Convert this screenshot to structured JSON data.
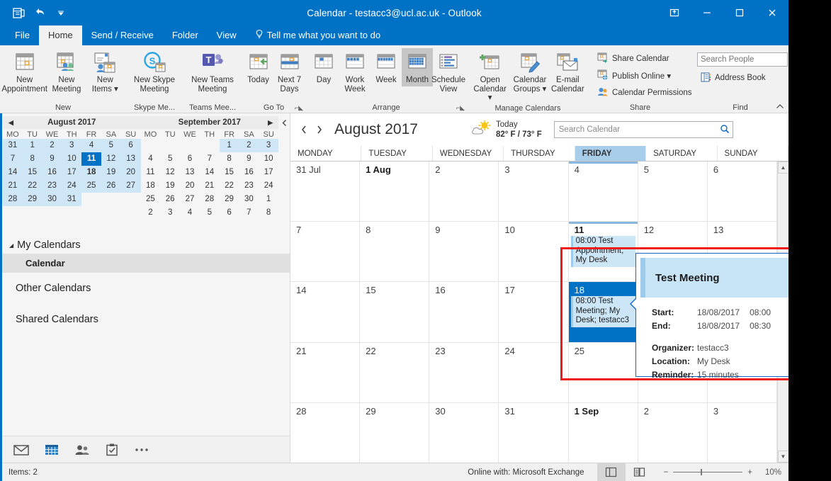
{
  "window": {
    "title": "Calendar - testacc3@ucl.ac.uk - Outlook",
    "restore_icon": "restore-window-icon",
    "minimize_icon": "minimize-icon",
    "maximize_icon": "maximize-icon",
    "close_icon": "close-icon",
    "qat": {
      "app_icon": "outlook-calendar-icon",
      "undo_icon": "undo-icon",
      "customize_icon": "chevron-down-icon"
    }
  },
  "tabs": [
    {
      "label": "File",
      "active": false
    },
    {
      "label": "Home",
      "active": true
    },
    {
      "label": "Send / Receive",
      "active": false
    },
    {
      "label": "Folder",
      "active": false
    },
    {
      "label": "View",
      "active": false
    }
  ],
  "tellme": {
    "label": "Tell me what you want to do",
    "icon": "lightbulb-icon"
  },
  "ribbon": {
    "groups": [
      {
        "label": "New",
        "buttons": [
          {
            "label": "New\nAppointment",
            "icon": "new-appointment-icon",
            "selected": false
          },
          {
            "label": "New\nMeeting",
            "icon": "new-meeting-icon",
            "selected": false
          },
          {
            "label": "New\nItems ▾",
            "icon": "new-items-icon",
            "selected": false
          }
        ]
      },
      {
        "label": "Skype Me...",
        "buttons": [
          {
            "label": "New Skype\nMeeting",
            "icon": "skype-meeting-icon",
            "selected": false
          }
        ]
      },
      {
        "label": "Teams Mee...",
        "buttons": [
          {
            "label": "New Teams\nMeeting",
            "icon": "teams-meeting-icon",
            "selected": false
          }
        ]
      },
      {
        "label": "Go To",
        "has_launcher": true,
        "buttons": [
          {
            "label": "Today",
            "icon": "today-icon",
            "selected": false
          },
          {
            "label": "Next 7\nDays",
            "icon": "next-7-days-icon",
            "selected": false
          }
        ]
      },
      {
        "label": "Arrange",
        "has_launcher": true,
        "buttons": [
          {
            "label": "Day",
            "icon": "day-view-icon",
            "selected": false
          },
          {
            "label": "Work\nWeek",
            "icon": "work-week-view-icon",
            "selected": false
          },
          {
            "label": "Week",
            "icon": "week-view-icon",
            "selected": false
          },
          {
            "label": "Month",
            "icon": "month-view-icon",
            "selected": true
          },
          {
            "label": "Schedule\nView",
            "icon": "schedule-view-icon",
            "selected": false
          }
        ]
      },
      {
        "label": "Manage Calendars",
        "buttons": [
          {
            "label": "Open\nCalendar ▾",
            "icon": "open-calendar-icon",
            "selected": false
          },
          {
            "label": "Calendar\nGroups ▾",
            "icon": "calendar-groups-icon",
            "selected": false
          },
          {
            "label": "E-mail\nCalendar",
            "icon": "email-calendar-icon",
            "selected": false
          }
        ]
      },
      {
        "label": "Share",
        "small_buttons": [
          {
            "label": "Share Calendar",
            "icon": "share-calendar-icon"
          },
          {
            "label": "Publish Online ▾",
            "icon": "publish-online-icon"
          },
          {
            "label": "Calendar Permissions",
            "icon": "calendar-permissions-icon"
          }
        ]
      },
      {
        "label": "Find",
        "search_people_placeholder": "Search People",
        "address_book_label": "Address Book",
        "address_book_icon": "address-book-icon"
      }
    ],
    "collapse_icon": "chevron-up-icon"
  },
  "navpane": {
    "minicals": [
      {
        "title": "August 2017",
        "prev_arrow": "◀",
        "next_arrow": "",
        "dow": [
          "MO",
          "TU",
          "WE",
          "TH",
          "FR",
          "SA",
          "SU"
        ],
        "weeks": [
          [
            {
              "d": "31",
              "in": true,
              "today": false,
              "bold": false
            },
            {
              "d": "1",
              "in": true
            },
            {
              "d": "2",
              "in": true
            },
            {
              "d": "3",
              "in": true
            },
            {
              "d": "4",
              "in": true
            },
            {
              "d": "5",
              "in": true
            },
            {
              "d": "6",
              "in": true
            }
          ],
          [
            {
              "d": "7",
              "in": true
            },
            {
              "d": "8",
              "in": true
            },
            {
              "d": "9",
              "in": true
            },
            {
              "d": "10",
              "in": true
            },
            {
              "d": "11",
              "in": true,
              "today": true
            },
            {
              "d": "12",
              "in": true
            },
            {
              "d": "13",
              "in": true
            }
          ],
          [
            {
              "d": "14",
              "in": true
            },
            {
              "d": "15",
              "in": true
            },
            {
              "d": "16",
              "in": true
            },
            {
              "d": "17",
              "in": true
            },
            {
              "d": "18",
              "in": true,
              "bold": true
            },
            {
              "d": "19",
              "in": true
            },
            {
              "d": "20",
              "in": true
            }
          ],
          [
            {
              "d": "21",
              "in": true
            },
            {
              "d": "22",
              "in": true
            },
            {
              "d": "23",
              "in": true
            },
            {
              "d": "24",
              "in": true
            },
            {
              "d": "25",
              "in": true
            },
            {
              "d": "26",
              "in": true
            },
            {
              "d": "27",
              "in": true
            }
          ],
          [
            {
              "d": "28",
              "in": true
            },
            {
              "d": "29",
              "in": true
            },
            {
              "d": "30",
              "in": true
            },
            {
              "d": "31",
              "in": true
            },
            {
              "d": "",
              "in": false
            },
            {
              "d": "",
              "in": false
            },
            {
              "d": "",
              "in": false
            }
          ],
          [
            {
              "d": "",
              "in": false
            },
            {
              "d": "",
              "in": false
            },
            {
              "d": "",
              "in": false
            },
            {
              "d": "",
              "in": false
            },
            {
              "d": "",
              "in": false
            },
            {
              "d": "",
              "in": false
            },
            {
              "d": "",
              "in": false
            }
          ]
        ]
      },
      {
        "title": "September 2017",
        "prev_arrow": "",
        "next_arrow": "▶",
        "dow": [
          "MO",
          "TU",
          "WE",
          "TH",
          "FR",
          "SA",
          "SU"
        ],
        "weeks": [
          [
            {
              "d": "",
              "in": false
            },
            {
              "d": "",
              "in": false
            },
            {
              "d": "",
              "in": false
            },
            {
              "d": "",
              "in": false
            },
            {
              "d": "1",
              "in": true
            },
            {
              "d": "2",
              "in": true
            },
            {
              "d": "3",
              "in": true
            }
          ],
          [
            {
              "d": "4"
            },
            {
              "d": "5"
            },
            {
              "d": "6"
            },
            {
              "d": "7"
            },
            {
              "d": "8"
            },
            {
              "d": "9"
            },
            {
              "d": "10"
            }
          ],
          [
            {
              "d": "11"
            },
            {
              "d": "12"
            },
            {
              "d": "13"
            },
            {
              "d": "14"
            },
            {
              "d": "15"
            },
            {
              "d": "16"
            },
            {
              "d": "17"
            }
          ],
          [
            {
              "d": "18"
            },
            {
              "d": "19"
            },
            {
              "d": "20"
            },
            {
              "d": "21"
            },
            {
              "d": "22"
            },
            {
              "d": "23"
            },
            {
              "d": "24"
            }
          ],
          [
            {
              "d": "25"
            },
            {
              "d": "26"
            },
            {
              "d": "27"
            },
            {
              "d": "28"
            },
            {
              "d": "29"
            },
            {
              "d": "30"
            },
            {
              "d": "1"
            }
          ],
          [
            {
              "d": "2"
            },
            {
              "d": "3"
            },
            {
              "d": "4"
            },
            {
              "d": "5"
            },
            {
              "d": "6"
            },
            {
              "d": "7"
            },
            {
              "d": "8"
            }
          ]
        ]
      }
    ],
    "my_calendars_label": "My Calendars",
    "calendar_item_label": "Calendar",
    "other_calendars_label": "Other Calendars",
    "shared_calendars_label": "Shared Calendars",
    "module_icons": [
      "mail-icon",
      "calendar-icon",
      "people-icon",
      "tasks-icon",
      "more-options-icon"
    ]
  },
  "calendar": {
    "prev_icon": "previous-arrow-icon",
    "next_icon": "next-arrow-icon",
    "title": "August 2017",
    "weather": {
      "icon": "partly-cloudy-icon",
      "day_label": "Today",
      "temps": "82° F / 73° F"
    },
    "search_placeholder": "Search Calendar",
    "search_icon": "search-icon",
    "day_headers": [
      "MONDAY",
      "TUESDAY",
      "WEDNESDAY",
      "THURSDAY",
      "FRIDAY",
      "SATURDAY",
      "SUNDAY"
    ],
    "highlighted_day_header": "FRIDAY",
    "weeks": [
      [
        {
          "num": "31 Jul",
          "bold": false
        },
        {
          "num": "1 Aug",
          "bold": true
        },
        {
          "num": "2"
        },
        {
          "num": "3"
        },
        {
          "num": "4",
          "todaycol": true
        },
        {
          "num": "5"
        },
        {
          "num": "6"
        }
      ],
      [
        {
          "num": "7"
        },
        {
          "num": "8"
        },
        {
          "num": "9"
        },
        {
          "num": "10"
        },
        {
          "num": "11",
          "bold": true,
          "todaycol": true,
          "appts": [
            {
              "text": "08:00 Test Appointment; My Desk"
            }
          ]
        },
        {
          "num": "12"
        },
        {
          "num": "13"
        }
      ],
      [
        {
          "num": "14"
        },
        {
          "num": "15"
        },
        {
          "num": "16"
        },
        {
          "num": "17"
        },
        {
          "num": "18",
          "selected": true,
          "appts": [
            {
              "text": "08:00 Test Meeting; My Desk; testacc3"
            }
          ]
        },
        {
          "num": "19"
        },
        {
          "num": "20"
        }
      ],
      [
        {
          "num": "21"
        },
        {
          "num": "22"
        },
        {
          "num": "23"
        },
        {
          "num": "24"
        },
        {
          "num": "25"
        },
        {
          "num": "26"
        },
        {
          "num": "27"
        }
      ],
      [
        {
          "num": "28"
        },
        {
          "num": "29"
        },
        {
          "num": "30"
        },
        {
          "num": "31"
        },
        {
          "num": "1 Sep",
          "bold": true
        },
        {
          "num": "2"
        },
        {
          "num": "3"
        }
      ]
    ],
    "scroll_up_icon": "scroll-up-icon",
    "scroll_down_icon": "scroll-down-icon"
  },
  "tooltip": {
    "title": "Test Meeting",
    "start_label": "Start:",
    "start_date": "18/08/2017",
    "start_time": "08:00",
    "end_label": "End:",
    "end_date": "18/08/2017",
    "end_time": "08:30",
    "organizer_label": "Organizer:",
    "organizer_value": "testacc3",
    "location_label": "Location:",
    "location_value": "My Desk",
    "reminder_label": "Reminder:",
    "reminder_value": "15 minutes"
  },
  "statusbar": {
    "items_label": "Items: 2",
    "connection_label": "Online with: Microsoft Exchange",
    "normal_view_icon": "normal-view-icon",
    "reading_view_icon": "reading-view-icon",
    "zoom_out_label": "−",
    "zoom_in_label": "+",
    "zoom_level": "10%"
  },
  "colors": {
    "accent": "#0072c6",
    "highlight_red": "#ee1b1b",
    "appointment_bg": "#cce6f7",
    "selected_day": "#0072c6",
    "tooltip_border": "#1569c7"
  }
}
